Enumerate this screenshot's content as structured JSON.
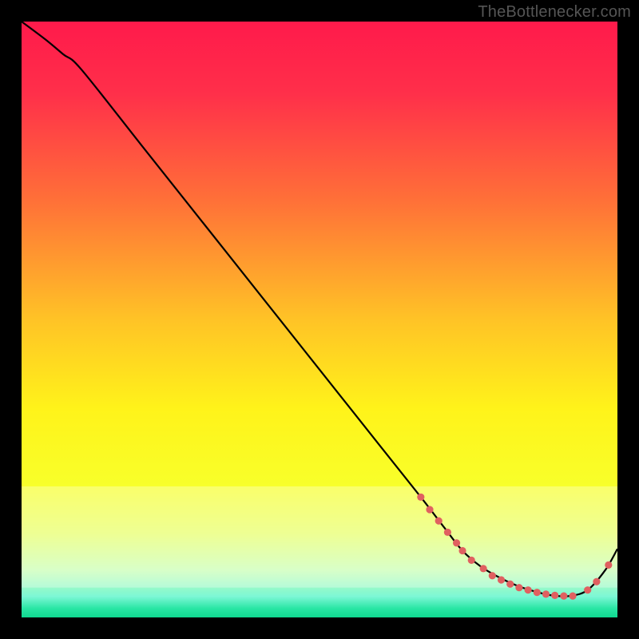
{
  "watermark": "TheBottlenecker.com",
  "chart_data": {
    "type": "line",
    "title": "",
    "xlabel": "",
    "ylabel": "",
    "xlim": [
      0,
      100
    ],
    "ylim": [
      0,
      100
    ],
    "gradient_stops": [
      {
        "offset": 0.0,
        "color": "#ff1a4b"
      },
      {
        "offset": 0.12,
        "color": "#ff2f4a"
      },
      {
        "offset": 0.3,
        "color": "#ff7038"
      },
      {
        "offset": 0.5,
        "color": "#ffc326"
      },
      {
        "offset": 0.65,
        "color": "#fff31a"
      },
      {
        "offset": 0.78,
        "color": "#f8ff2a"
      },
      {
        "offset": 0.86,
        "color": "#e7ff66"
      },
      {
        "offset": 0.92,
        "color": "#c8ffb0"
      },
      {
        "offset": 0.965,
        "color": "#7cf7d5"
      },
      {
        "offset": 0.985,
        "color": "#29e6a4"
      },
      {
        "offset": 1.0,
        "color": "#0fd98f"
      }
    ],
    "pale_band": {
      "y_top_frac": 0.78,
      "y_bottom_frac": 0.95,
      "opacity": 0.3
    },
    "series": [
      {
        "name": "bottleneck-curve",
        "color": "#000000",
        "x": [
          0,
          4,
          7,
          10,
          20,
          30,
          40,
          50,
          60,
          67,
          71,
          74,
          77,
          80,
          83,
          86,
          89,
          92,
          95,
          98,
          100
        ],
        "y": [
          100,
          97,
          94.5,
          92,
          79.4,
          66.8,
          54.2,
          41.6,
          29.0,
          20.2,
          15.0,
          11.2,
          8.6,
          6.8,
          5.4,
          4.4,
          3.7,
          3.6,
          4.6,
          8.0,
          11.5
        ]
      }
    ],
    "markers": {
      "color": "#e06060",
      "radius": 4.6,
      "points": [
        {
          "x": 67.0,
          "y": 20.2
        },
        {
          "x": 68.5,
          "y": 18.1
        },
        {
          "x": 70.0,
          "y": 16.2
        },
        {
          "x": 71.5,
          "y": 14.3
        },
        {
          "x": 73.0,
          "y": 12.5
        },
        {
          "x": 74.0,
          "y": 11.2
        },
        {
          "x": 75.5,
          "y": 9.6
        },
        {
          "x": 77.5,
          "y": 8.2
        },
        {
          "x": 79.0,
          "y": 7.0
        },
        {
          "x": 80.5,
          "y": 6.3
        },
        {
          "x": 82.0,
          "y": 5.6
        },
        {
          "x": 83.5,
          "y": 5.0
        },
        {
          "x": 85.0,
          "y": 4.6
        },
        {
          "x": 86.5,
          "y": 4.2
        },
        {
          "x": 88.0,
          "y": 3.9
        },
        {
          "x": 89.5,
          "y": 3.7
        },
        {
          "x": 91.0,
          "y": 3.6
        },
        {
          "x": 92.5,
          "y": 3.6
        },
        {
          "x": 95.0,
          "y": 4.6
        },
        {
          "x": 96.5,
          "y": 6.0
        },
        {
          "x": 98.5,
          "y": 8.8
        }
      ]
    }
  }
}
